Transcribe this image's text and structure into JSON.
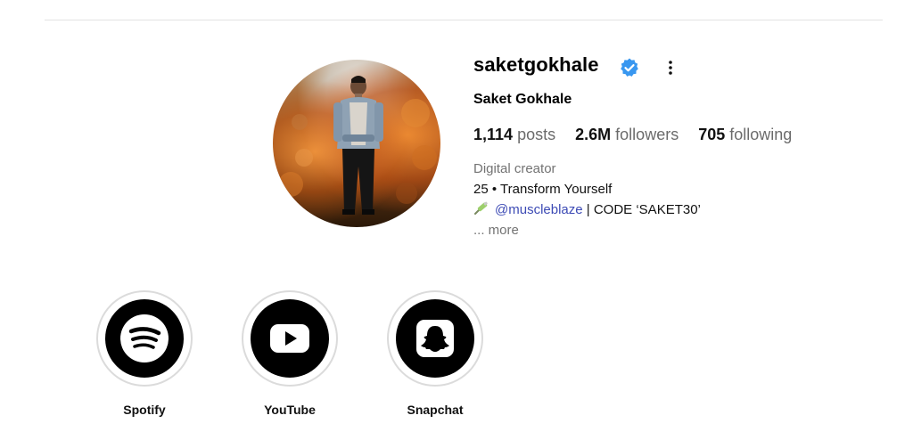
{
  "profile": {
    "username": "saketgokhale",
    "full_name": "Saket Gokhale",
    "stats": [
      {
        "value": "1,114",
        "label": "posts"
      },
      {
        "value": "2.6M",
        "label": "followers"
      },
      {
        "value": "705",
        "label": "following"
      }
    ],
    "bio": {
      "category": "Digital creator",
      "line1": "25 • Transform Yourself",
      "mention": "@muscleblaze",
      "code_text": " | CODE ‘SAKET30’",
      "more": "... more"
    },
    "verified_color": "#3897f0"
  },
  "highlights": [
    {
      "label": "Spotify",
      "icon": "spotify-icon"
    },
    {
      "label": "YouTube",
      "icon": "youtube-icon"
    },
    {
      "label": "Snapchat",
      "icon": "snapchat-icon"
    }
  ]
}
